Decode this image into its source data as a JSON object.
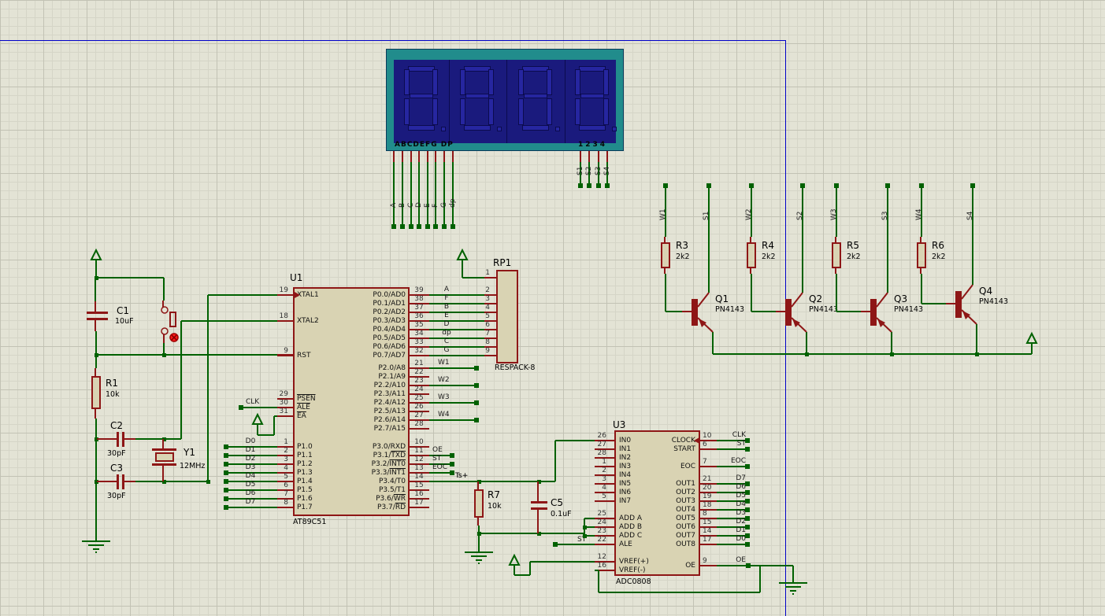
{
  "display": {
    "segment_row_label": "ABCDEFG DP",
    "digit_row_label": "1234",
    "segment_pins": [
      "A",
      "B",
      "C",
      "D",
      "E",
      "F",
      "G",
      "dp"
    ],
    "digit_pins": [
      "S1",
      "S2",
      "S3",
      "S4"
    ],
    "digit_count": 4
  },
  "u1": {
    "ref": "U1",
    "value": "AT89C51",
    "left_pins": [
      {
        "num": "19",
        "name": "XTAL1"
      },
      {
        "num": "18",
        "name": "XTAL2"
      },
      {
        "num": "9",
        "name": "RST"
      },
      {
        "num": "29",
        "name": "PSEN",
        "ov_all": true
      },
      {
        "num": "30",
        "name": "ALE",
        "ov_all": true,
        "net": "CLK"
      },
      {
        "num": "31",
        "name": "EA",
        "ov_all": true
      },
      {
        "num": "1",
        "name": "P1.0",
        "net": "D0"
      },
      {
        "num": "2",
        "name": "P1.1",
        "net": "D1"
      },
      {
        "num": "3",
        "name": "P1.2",
        "net": "D2"
      },
      {
        "num": "4",
        "name": "P1.3",
        "net": "D3"
      },
      {
        "num": "5",
        "name": "P1.4",
        "net": "D4"
      },
      {
        "num": "6",
        "name": "P1.5",
        "net": "D5"
      },
      {
        "num": "7",
        "name": "P1.6",
        "net": "D6"
      },
      {
        "num": "8",
        "name": "P1.7",
        "net": "D7"
      }
    ],
    "right_pins": [
      {
        "num": "39",
        "name": "P0.0/AD0",
        "net": "A"
      },
      {
        "num": "38",
        "name": "P0.1/AD1",
        "net": "F"
      },
      {
        "num": "37",
        "name": "P0.2/AD2",
        "net": "B"
      },
      {
        "num": "36",
        "name": "P0.3/AD3",
        "net": "E"
      },
      {
        "num": "35",
        "name": "P0.4/AD4",
        "net": "D"
      },
      {
        "num": "34",
        "name": "P0.5/AD5",
        "net": "dp"
      },
      {
        "num": "33",
        "name": "P0.6/AD6",
        "net": "C"
      },
      {
        "num": "32",
        "name": "P0.7/AD7",
        "net": "G"
      },
      {
        "num": "21",
        "name": "P2.0/A8",
        "net": "W1"
      },
      {
        "num": "22",
        "name": "P2.1/A9"
      },
      {
        "num": "23",
        "name": "P2.2/A10",
        "net": "W2"
      },
      {
        "num": "24",
        "name": "P2.3/A11"
      },
      {
        "num": "25",
        "name": "P2.4/A12",
        "net": "W3"
      },
      {
        "num": "26",
        "name": "P2.5/A13"
      },
      {
        "num": "27",
        "name": "P2.6/A14",
        "net": "W4"
      },
      {
        "num": "28",
        "name": "P2.7/A15"
      },
      {
        "num": "10",
        "name": "P3.0/RXD"
      },
      {
        "num": "11",
        "pre": "P3.1/",
        "ovpart": "TXD",
        "net": "OE"
      },
      {
        "num": "12",
        "pre": "P3.2/",
        "ovpart": "INT0",
        "net": "ST"
      },
      {
        "num": "13",
        "pre": "P3.3/",
        "ovpart": "INT1",
        "net": "EOC"
      },
      {
        "num": "14",
        "name": "P3.4/T0",
        "net": "Ts+"
      },
      {
        "num": "15",
        "name": "P3.5/T1"
      },
      {
        "num": "16",
        "pre": "P3.6/",
        "ovpart": "WR"
      },
      {
        "num": "17",
        "pre": "P3.7/",
        "ovpart": "RD"
      }
    ]
  },
  "rp1": {
    "ref": "RP1",
    "value": "RESPACK-8",
    "pins": [
      "1",
      "2",
      "3",
      "4",
      "5",
      "6",
      "7",
      "8",
      "9"
    ]
  },
  "u3": {
    "ref": "U3",
    "value": "ADC0808",
    "left_pins": [
      {
        "num": "26",
        "name": "IN0"
      },
      {
        "num": "27",
        "name": "IN1"
      },
      {
        "num": "28",
        "name": "IN2"
      },
      {
        "num": "1",
        "name": "IN3"
      },
      {
        "num": "2",
        "name": "IN4"
      },
      {
        "num": "3",
        "name": "IN5"
      },
      {
        "num": "4",
        "name": "IN6"
      },
      {
        "num": "5",
        "name": "IN7"
      },
      {
        "num": "25",
        "name": "ADD A"
      },
      {
        "num": "24",
        "name": "ADD B"
      },
      {
        "num": "23",
        "name": "ADD C"
      },
      {
        "num": "22",
        "name": "ALE",
        "net": "ST"
      },
      {
        "num": "12",
        "name": "VREF(+)"
      },
      {
        "num": "16",
        "name": "VREF(-)"
      }
    ],
    "right_pins": [
      {
        "num": "10",
        "name": "CLOCK",
        "net": "CLK"
      },
      {
        "num": "6",
        "name": "START",
        "net": "ST"
      },
      {
        "num": "7",
        "name": "EOC",
        "net": "EOC"
      },
      {
        "num": "21",
        "name": "OUT1",
        "net": "D7"
      },
      {
        "num": "20",
        "name": "OUT2",
        "net": "D6"
      },
      {
        "num": "19",
        "name": "OUT3",
        "net": "D5"
      },
      {
        "num": "18",
        "name": "OUT4",
        "net": "D4"
      },
      {
        "num": "8",
        "name": "OUT5",
        "net": "D3"
      },
      {
        "num": "15",
        "name": "OUT6",
        "net": "D2"
      },
      {
        "num": "14",
        "name": "OUT7",
        "net": "D1"
      },
      {
        "num": "17",
        "name": "OUT8",
        "net": "D0"
      },
      {
        "num": "9",
        "name": "OE",
        "net": "OE"
      }
    ]
  },
  "drivers": [
    {
      "w": "W1",
      "s": "S1",
      "r_ref": "R3",
      "r_value": "2k2",
      "q_ref": "Q1",
      "q_value": "PN4143"
    },
    {
      "w": "W2",
      "s": "S2",
      "r_ref": "R4",
      "r_value": "2k2",
      "q_ref": "Q2",
      "q_value": "PN4143"
    },
    {
      "w": "W3",
      "s": "S3",
      "r_ref": "R5",
      "r_value": "2k2",
      "q_ref": "Q3",
      "q_value": "PN4143"
    },
    {
      "w": "W4",
      "s": "S4",
      "r_ref": "R6",
      "r_value": "2k2",
      "q_ref": "Q4",
      "q_value": "PN4143"
    }
  ],
  "parts": {
    "c1": {
      "ref": "C1",
      "value": "10uF"
    },
    "r1": {
      "ref": "R1",
      "value": "10k"
    },
    "c2": {
      "ref": "C2",
      "value": "30pF"
    },
    "c3": {
      "ref": "C3",
      "value": "30pF"
    },
    "y1": {
      "ref": "Y1",
      "value": "12MHz"
    },
    "r7": {
      "ref": "R7",
      "value": "10k"
    },
    "c5": {
      "ref": "C5",
      "value": "0.1uF"
    }
  },
  "nets": {
    "ts": "Ts+"
  },
  "colors": {
    "wire": "#006100",
    "component_outline": "#8e1616",
    "component_fill": "#d9d3b3",
    "display_frame": "#218c8c",
    "display_panel": "#1a1a7d",
    "display_segment": "#2626a0",
    "sheet_border": "#0000c8",
    "grid_minor": "#d5d5c7",
    "grid_major": "#c2c2b4"
  }
}
